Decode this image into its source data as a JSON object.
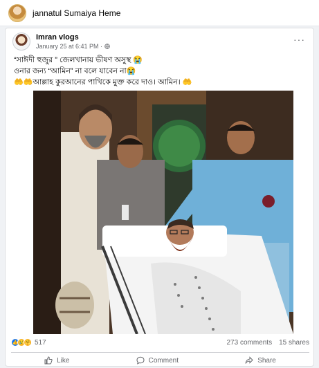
{
  "top_bar": {
    "name": "jannatul Sumaiya Heme"
  },
  "post": {
    "author": "Imran vlogs",
    "time": "January 25 at 6:41 PM · ",
    "more": "···",
    "text_lines": [
      "“সাঈদী হুজুর ” জেলখানায় ভীষণ অসুস্থ 😭",
      "ওনার জন্য “আমিন” না বলে যাবেন না😭",
      "🤲🤲আল্লাহ কুরআনের পাখিকে মুক্ত করে দাও। আমিন। 🤲"
    ],
    "image_description_icon": "hospital-stretcher-photo"
  },
  "stats": {
    "reaction_count": "517",
    "comments": "273 comments",
    "shares": "15 shares"
  },
  "actions": {
    "like": "Like",
    "comment": "Comment",
    "share": "Share"
  },
  "colors": {
    "accent": "#1877f2",
    "muted": "#65676b",
    "background": "#f0f2f5"
  }
}
